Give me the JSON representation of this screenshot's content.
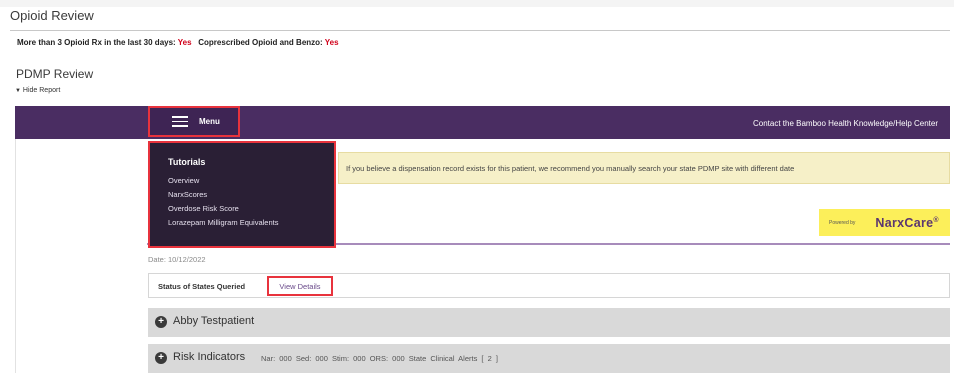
{
  "header": {
    "title": "Opioid Review"
  },
  "alerts": {
    "opioid_label": "More than 3 Opioid Rx in the last 30 days:",
    "opioid_value": "Yes",
    "benzo_label": "Coprescribed Opioid and Benzo:",
    "benzo_value": "Yes"
  },
  "pdmp": {
    "title": "PDMP Review",
    "hide_report": "Hide Report",
    "menu_label": "Menu",
    "contact_link": "Contact the Bamboo Health Knowledge/Help Center",
    "menu": {
      "heading": "Tutorials",
      "items": [
        "Overview",
        "NarxScores",
        "Overdose Risk Score",
        "Lorazepam Milligram Equivalents"
      ]
    },
    "notice": "If you believe a dispensation record exists for this patient, we recommend you manually search your state PDMP site with different date",
    "powered_by": "Powered by",
    "brand": "NarxCare",
    "brand_mark": "®",
    "date_line": "Date: 10/12/2022",
    "status_label": "Status of States Queried",
    "view_details": "View Details",
    "patient_name": "Abby Testpatient",
    "risk": {
      "label": "Risk Indicators",
      "metrics": "Nar: 000   Sed: 000   Stim: 000   ORS: 000   State Clinical Alerts [ 2 ]"
    }
  },
  "colors": {
    "bar_purple": "#4a2d62",
    "alert_red": "#d0021b",
    "highlight_red": "#e8333d",
    "badge_yellow": "#fcef5a",
    "notice_bg": "#f6f0c8"
  },
  "icons": [
    "hamburger-icon",
    "triangle-down-icon",
    "plus-circle-icon"
  ]
}
